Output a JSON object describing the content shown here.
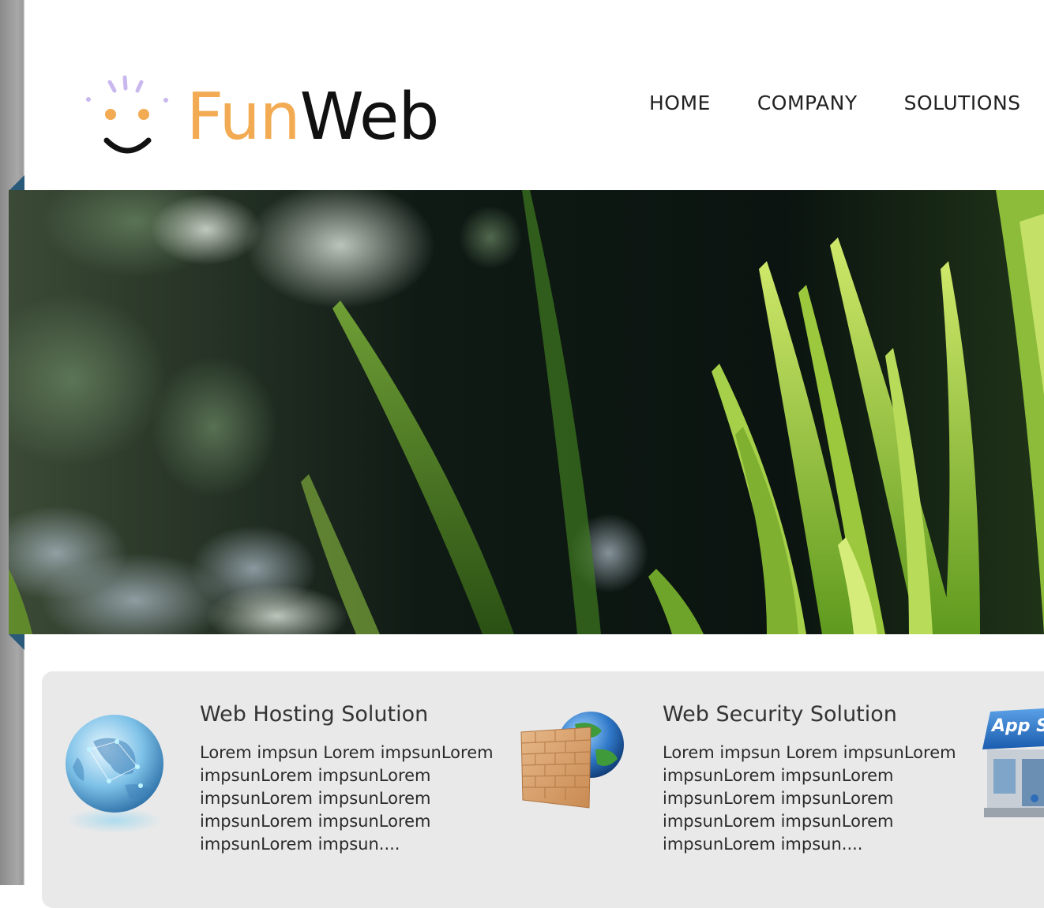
{
  "site": {
    "logo": {
      "fun": "Fun",
      "web": "Web"
    }
  },
  "nav": {
    "items": [
      {
        "label": "HOME"
      },
      {
        "label": "COMPANY"
      },
      {
        "label": "SOLUTIONS"
      }
    ]
  },
  "banner": {
    "subject": "grass-photo"
  },
  "features": [
    {
      "title": "Web Hosting Solution",
      "text": "Lorem impsun Lorem impsunLorem impsunLorem impsunLorem impsunLorem impsunLorem impsunLorem impsunLorem impsunLorem impsun....",
      "icon": "globe-icon"
    },
    {
      "title": "Web Security Solution",
      "text": "Lorem impsun Lorem impsunLorem impsunLorem impsunLorem impsunLorem impsunLorem impsunLorem impsunLorem impsunLorem impsun....",
      "icon": "firewall-globe-icon"
    },
    {
      "badge": "App S",
      "icon": "app-store-icon"
    }
  ],
  "colors": {
    "logo_accent": "#f2ab52",
    "logo_dark": "#111111",
    "panel_bg": "#e9e9e9",
    "banner_tab": "#2a5a7a"
  }
}
